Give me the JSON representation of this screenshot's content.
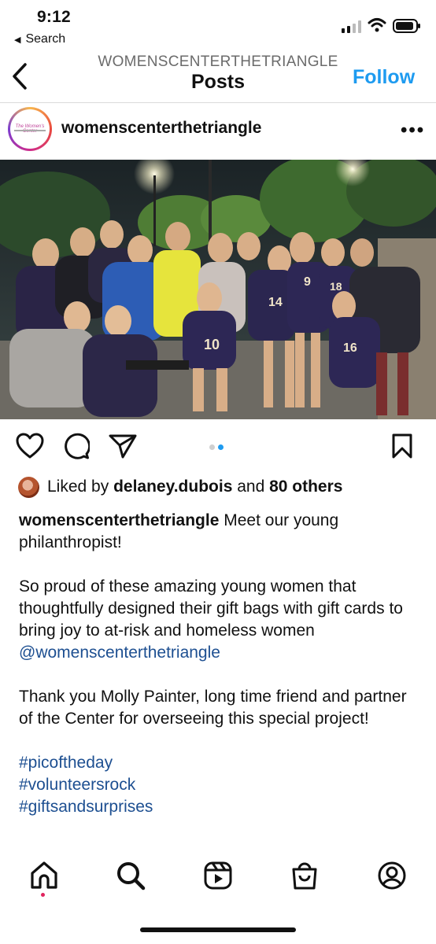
{
  "status_bar": {
    "time": "9:12",
    "back_app": "Search"
  },
  "header": {
    "username": "WOMENSCENTERTHETRIANGLE",
    "title": "Posts",
    "follow_label": "Follow"
  },
  "post": {
    "author": "womenscenterthetriangle",
    "avatar_text": "The Women's Center",
    "more_icon": "ellipsis-icon",
    "carousel": {
      "count": 2,
      "active": 2
    },
    "likes": {
      "prefix": "Liked by ",
      "user": "delaney.dubois",
      "middle": " and ",
      "others": "80 others"
    },
    "caption": {
      "user": "womenscenterthetriangle",
      "p1": " Meet our young philanthropist!",
      "p2_text": "So proud of these amazing young women that thoughtfully designed their gift bags with gift cards to bring joy to at-risk and homeless women ",
      "p2_mention": "@womenscenterthetriangle",
      "p3": "Thank you Molly Painter, long time friend and partner of the Center for overseeing this special project!",
      "hashtags": [
        "#picoftheday",
        "#volunteersrock",
        "#giftsandsurprises"
      ]
    },
    "jersey_numbers": [
      "9",
      "14",
      "10",
      "16",
      "18"
    ]
  },
  "tab_bar": {
    "items": [
      "home-icon",
      "search-icon",
      "reels-icon",
      "shop-icon",
      "profile-icon"
    ]
  },
  "colors": {
    "accent": "#1e9bf0",
    "link": "#1d4f91",
    "notification": "#e0245e"
  }
}
